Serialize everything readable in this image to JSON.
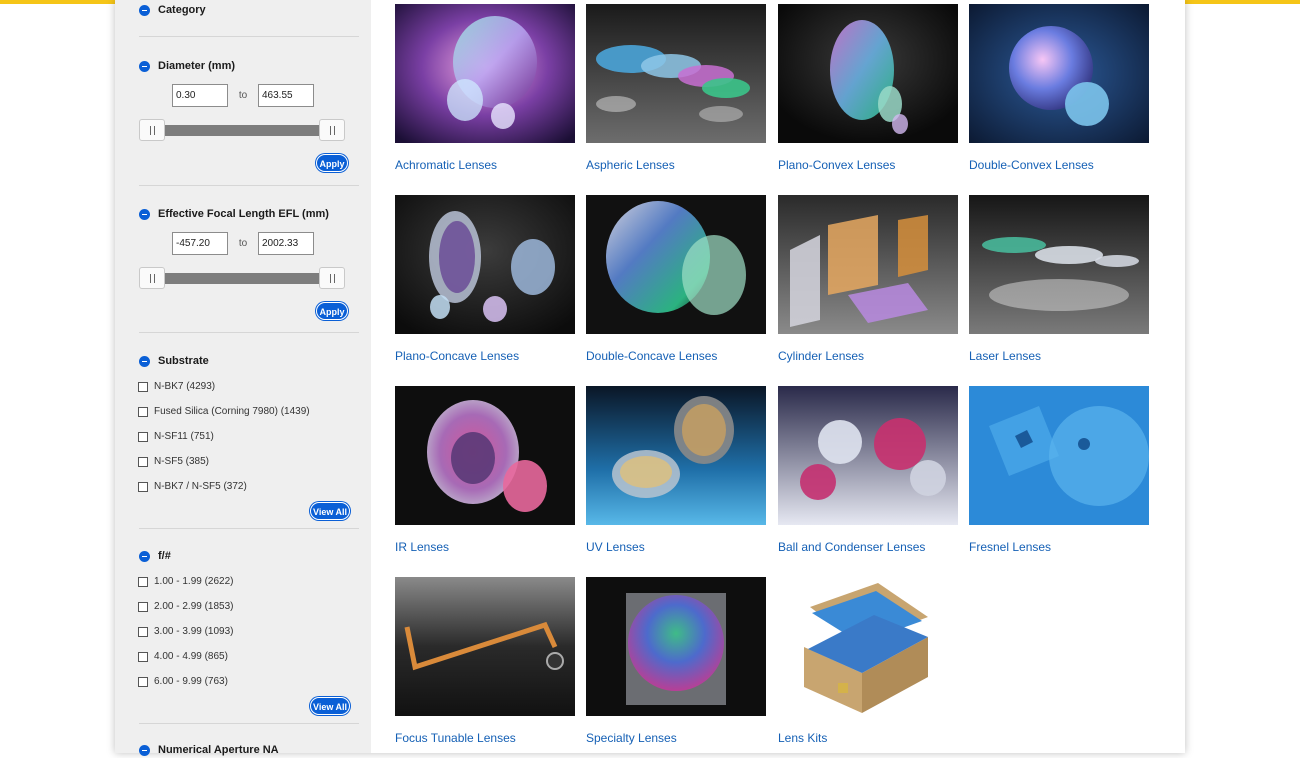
{
  "filters": {
    "category": {
      "title": "Category"
    },
    "diameter": {
      "title": "Diameter (mm)",
      "min": "0.30",
      "max": "463.55",
      "to_label": "to",
      "apply_label": "Apply"
    },
    "efl": {
      "title": "Effective Focal Length EFL (mm)",
      "min": "-457.20",
      "max": "2002.33",
      "to_label": "to",
      "apply_label": "Apply"
    },
    "substrate": {
      "title": "Substrate",
      "options": [
        "N-BK7 (4293)",
        "Fused Silica (Corning 7980) (1439)",
        "N-SF11 (751)",
        "N-SF5 (385)",
        "N-BK7 / N-SF5 (372)"
      ],
      "view_all_label": "View All"
    },
    "fnumber": {
      "title": "f/#",
      "options": [
        "1.00 - 1.99 (2622)",
        "2.00 - 2.99 (1853)",
        "3.00 - 3.99 (1093)",
        "4.00 - 4.99 (865)",
        "6.00 - 9.99 (763)"
      ],
      "view_all_label": "View All"
    },
    "na": {
      "title": "Numerical Aperture NA"
    }
  },
  "products": [
    {
      "label": "Achromatic Lenses",
      "icon": "achromatic-lens-image"
    },
    {
      "label": "Aspheric Lenses",
      "icon": "aspheric-lens-image"
    },
    {
      "label": "Plano-Convex Lenses",
      "icon": "plano-convex-lens-image"
    },
    {
      "label": "Double-Convex Lenses",
      "icon": "double-convex-lens-image"
    },
    {
      "label": "Plano-Concave Lenses",
      "icon": "plano-concave-lens-image"
    },
    {
      "label": "Double-Concave Lenses",
      "icon": "double-concave-lens-image"
    },
    {
      "label": "Cylinder Lenses",
      "icon": "cylinder-lens-image"
    },
    {
      "label": "Laser Lenses",
      "icon": "laser-lens-image"
    },
    {
      "label": "IR Lenses",
      "icon": "ir-lens-image"
    },
    {
      "label": "UV Lenses",
      "icon": "uv-lens-image"
    },
    {
      "label": "Ball and Condenser Lenses",
      "icon": "ball-lens-image"
    },
    {
      "label": "Fresnel Lenses",
      "icon": "fresnel-lens-image"
    },
    {
      "label": "Focus Tunable Lenses",
      "icon": "tunable-lens-image"
    },
    {
      "label": "Specialty Lenses",
      "icon": "specialty-lens-image"
    },
    {
      "label": "Lens Kits",
      "icon": "lens-kit-image"
    }
  ],
  "colors": {
    "accent": "#0a5fd6",
    "link": "#1560b5",
    "topbar": "#f5c518",
    "sidebar_bg": "#efefef"
  }
}
